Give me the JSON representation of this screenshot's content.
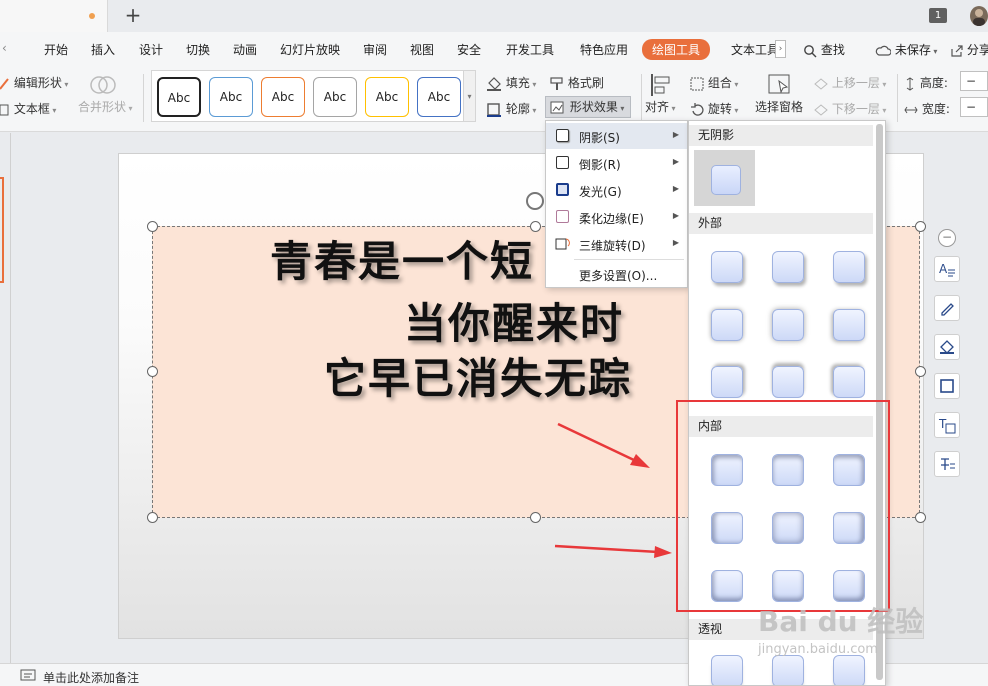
{
  "titlebar": {
    "new_tab_symbol": "+",
    "window_badge": "1"
  },
  "menubar": {
    "left_arrow": "‹",
    "items": [
      "开始",
      "插入",
      "设计",
      "切换",
      "动画",
      "幻灯片放映",
      "审阅",
      "视图",
      "安全",
      "开发工具",
      "特色应用",
      "绘图工具",
      "文本工具"
    ],
    "active_item": "绘图工具",
    "more_arrow": "›",
    "search_label": "查找",
    "save_status": "未保存",
    "share_label": "分享"
  },
  "ribbon": {
    "edit_shape": "编辑形状",
    "text_box": "文本框",
    "merge_shape": "合并形状",
    "style_samples": [
      "Abc",
      "Abc",
      "Abc",
      "Abc",
      "Abc",
      "Abc"
    ],
    "style_border_colors": [
      "#222222",
      "#5b9bd5",
      "#ed7d31",
      "#a5a5a5",
      "#ffc000",
      "#4472c4"
    ],
    "fill": "填充",
    "format_painter": "格式刷",
    "outline": "轮廓",
    "shape_effect": "形状效果",
    "group": "组合",
    "align": "对齐",
    "rotate": "旋转",
    "selection_pane": "选择窗格",
    "bring_forward": "上移一层",
    "send_backward": "下移一层",
    "height_label": "高度:",
    "width_label": "宽度:",
    "stepper_minus": "−"
  },
  "slide": {
    "line1": "青春是一个短",
    "line2": "当你醒来时",
    "line3": "它早已消失无踪"
  },
  "dropdown": {
    "items": [
      {
        "label": "阴影(S)",
        "has_submenu": true
      },
      {
        "label": "倒影(R)",
        "has_submenu": true
      },
      {
        "label": "发光(G)",
        "has_submenu": true
      },
      {
        "label": "柔化边缘(E)",
        "has_submenu": true
      },
      {
        "label": "三维旋转(D)",
        "has_submenu": true
      },
      {
        "label": "更多设置(O)...",
        "has_submenu": false
      }
    ]
  },
  "shadow_panel": {
    "none_header": "无阴影",
    "outer_header": "外部",
    "inner_header": "内部",
    "perspective_header": "透视"
  },
  "status": {
    "notes_placeholder": "单击此处添加备注"
  },
  "watermark": {
    "brand": "Bai du 经验",
    "url": "jingyan.baidu.com"
  },
  "colors": {
    "accent": "#e96f3c",
    "annotation_red": "#e8383a",
    "textbox_fill": "#fce4d6"
  }
}
